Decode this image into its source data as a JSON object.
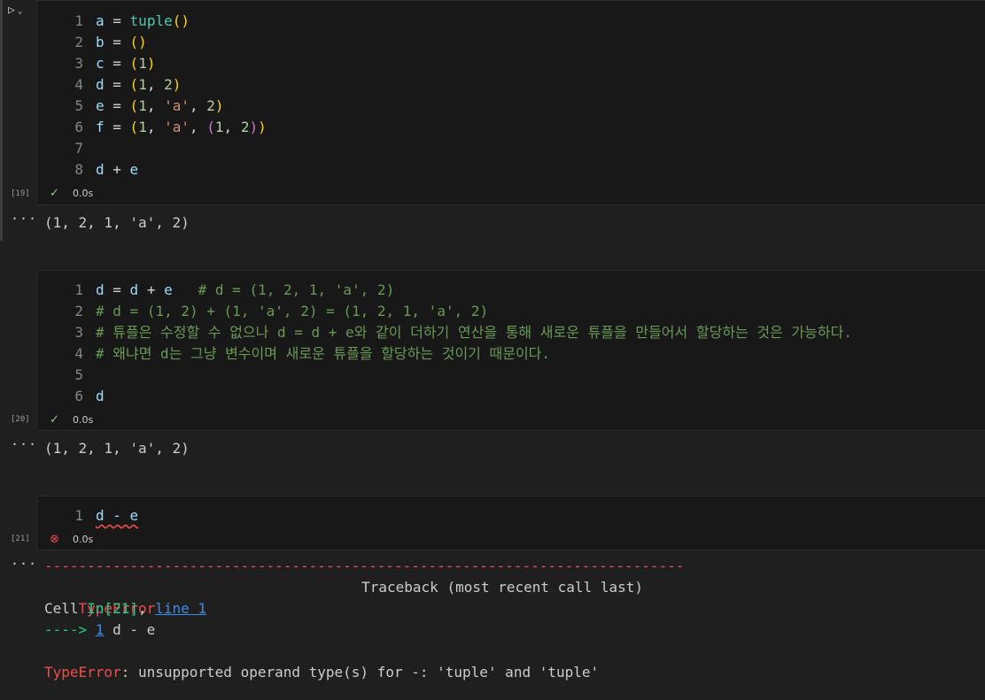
{
  "cells": [
    {
      "exec_count": "[19]",
      "status_time": "0.0s",
      "lines": [
        {
          "n": "1",
          "tokens": [
            [
              "var",
              "a"
            ],
            [
              "op",
              " = "
            ],
            [
              "fn",
              "tuple"
            ],
            [
              "b1",
              "()"
            ]
          ]
        },
        {
          "n": "2",
          "tokens": [
            [
              "var",
              "b"
            ],
            [
              "op",
              " = "
            ],
            [
              "b1",
              "()"
            ]
          ]
        },
        {
          "n": "3",
          "tokens": [
            [
              "var",
              "c"
            ],
            [
              "op",
              " = "
            ],
            [
              "b1",
              "("
            ],
            [
              "num",
              "1"
            ],
            [
              "b1",
              ")"
            ]
          ]
        },
        {
          "n": "4",
          "tokens": [
            [
              "var",
              "d"
            ],
            [
              "op",
              " = "
            ],
            [
              "b1",
              "("
            ],
            [
              "num",
              "1"
            ],
            [
              "op",
              ", "
            ],
            [
              "num",
              "2"
            ],
            [
              "b1",
              ")"
            ]
          ]
        },
        {
          "n": "5",
          "tokens": [
            [
              "var",
              "e"
            ],
            [
              "op",
              " = "
            ],
            [
              "b1",
              "("
            ],
            [
              "num",
              "1"
            ],
            [
              "op",
              ", "
            ],
            [
              "str",
              "'a'"
            ],
            [
              "op",
              ", "
            ],
            [
              "num",
              "2"
            ],
            [
              "b1",
              ")"
            ]
          ]
        },
        {
          "n": "6",
          "tokens": [
            [
              "var",
              "f"
            ],
            [
              "op",
              " = "
            ],
            [
              "b1",
              "("
            ],
            [
              "num",
              "1"
            ],
            [
              "op",
              ", "
            ],
            [
              "str",
              "'a'"
            ],
            [
              "op",
              ", "
            ],
            [
              "b2",
              "("
            ],
            [
              "num",
              "1"
            ],
            [
              "op",
              ", "
            ],
            [
              "num",
              "2"
            ],
            [
              "b2",
              ")"
            ],
            [
              "b1",
              ")"
            ]
          ]
        },
        {
          "n": "7",
          "tokens": []
        },
        {
          "n": "8",
          "tokens": [
            [
              "var",
              "d"
            ],
            [
              "op",
              " + "
            ],
            [
              "var",
              "e"
            ]
          ]
        }
      ],
      "output": "(1, 2, 1, 'a', 2)"
    },
    {
      "exec_count": "[20]",
      "status_time": "0.0s",
      "lines": [
        {
          "n": "1",
          "tokens": [
            [
              "var",
              "d"
            ],
            [
              "op",
              " = "
            ],
            [
              "var",
              "d"
            ],
            [
              "op",
              " + "
            ],
            [
              "var",
              "e"
            ],
            [
              "op",
              "   "
            ],
            [
              "cmt",
              "# d = (1, 2, 1, 'a', 2)"
            ]
          ]
        },
        {
          "n": "2",
          "tokens": [
            [
              "cmt",
              "# d = (1, 2) + (1, 'a', 2) = (1, 2, 1, 'a', 2)"
            ]
          ]
        },
        {
          "n": "3",
          "tokens": [
            [
              "cmt",
              "# 튜플은 수정할 수 없으나 d = d + e와 같이 더하기 연산을 통해 새로운 튜플을 만들어서 할당하는 것은 가능하다."
            ]
          ]
        },
        {
          "n": "4",
          "tokens": [
            [
              "cmt",
              "# 왜냐면 d는 그냥 변수이며 새로운 튜플을 할당하는 것이기 때문이다."
            ]
          ]
        },
        {
          "n": "5",
          "tokens": []
        },
        {
          "n": "6",
          "tokens": [
            [
              "var",
              "d"
            ]
          ]
        }
      ],
      "output": "(1, 2, 1, 'a', 2)"
    },
    {
      "exec_count": "[21]",
      "status_time": "0.0s",
      "lines": [
        {
          "n": "1",
          "tokens": [
            [
              "squig",
              "d - e"
            ]
          ]
        }
      ]
    }
  ],
  "traceback": {
    "dashes": "---------------------------------------------------------------------------",
    "error_name": "TypeError",
    "traceback_header": "Traceback (most recent call last)",
    "cell_prefix": "Cell ",
    "cell_ref": "In[21]",
    "comma": ", ",
    "line_ref": "line 1",
    "arrow": "----> ",
    "arrow_lineno": "1",
    "arrow_code": " d - e",
    "final_error": "TypeError",
    "final_message": ": unsupported operand type(s) for -: 'tuple' and 'tuple'"
  },
  "icons": {
    "run": "run-icon",
    "chevron": "chevron-down-icon",
    "success": "check-icon",
    "error": "error-circle-icon",
    "more": "ellipsis-icon"
  },
  "colors": {
    "background": "#1f1f1f",
    "editor": "#181818",
    "success": "#89d185",
    "error": "#f14c4c",
    "link": "#3b8eea"
  }
}
